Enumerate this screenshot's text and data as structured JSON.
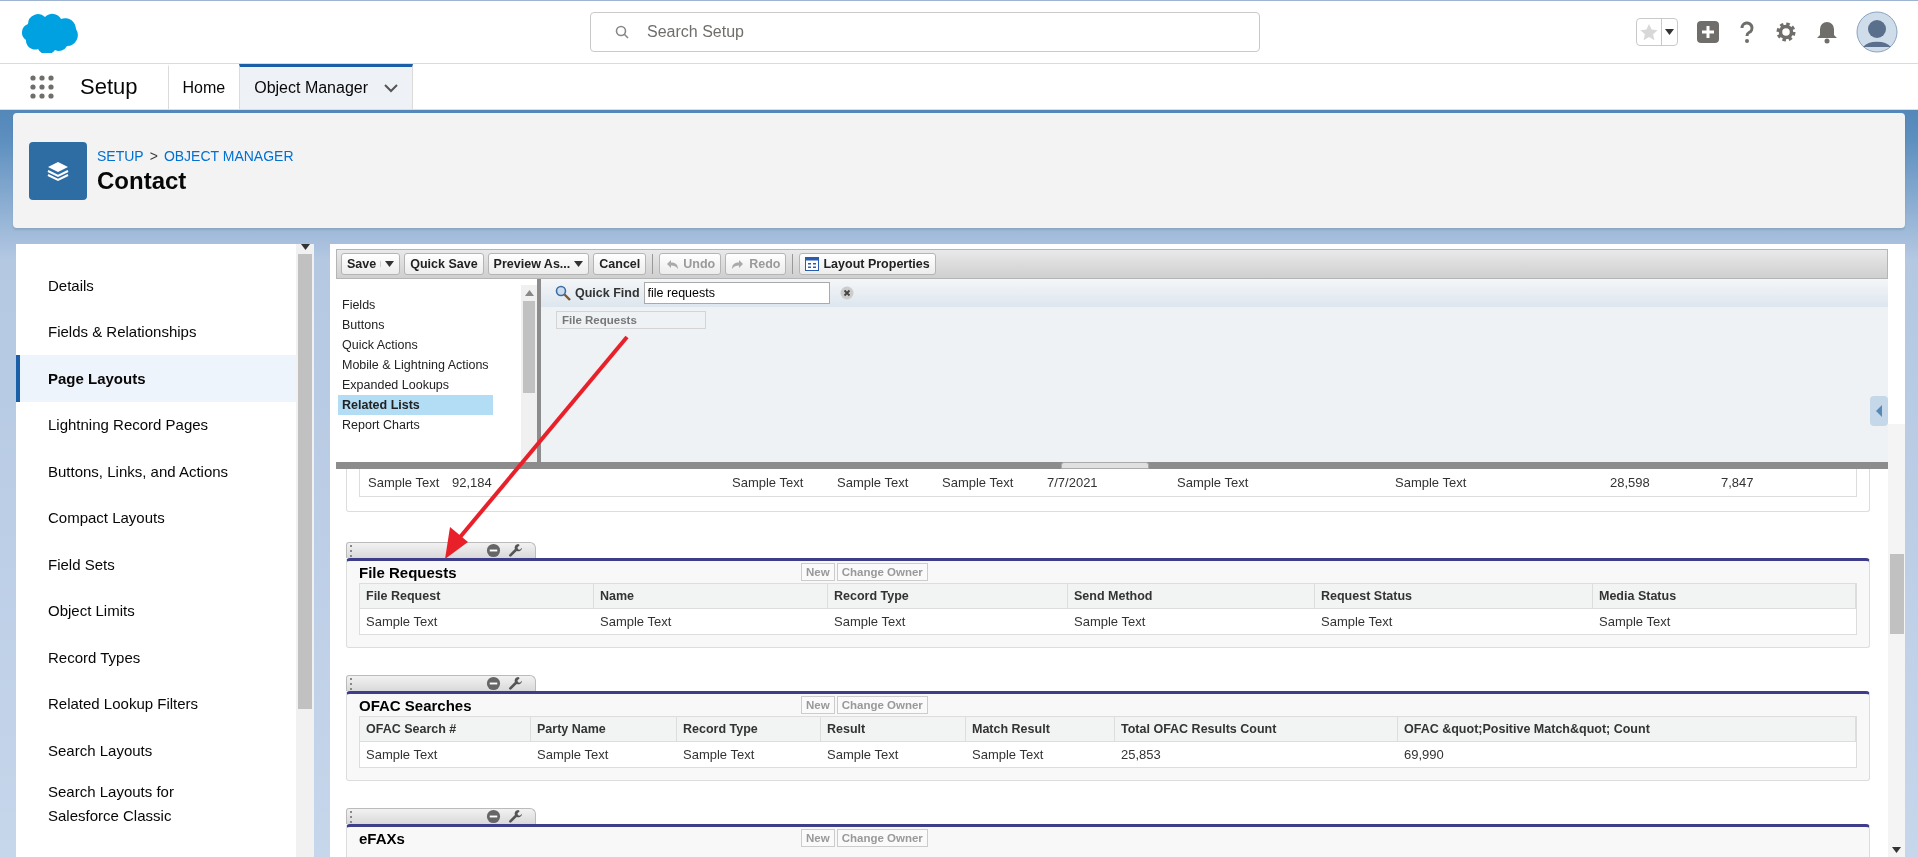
{
  "header": {
    "search": {
      "placeholder": "Search Setup"
    }
  },
  "nav": {
    "app_name": "Setup",
    "tabs": [
      {
        "label": "Home",
        "selected": false,
        "menu": false
      },
      {
        "label": "Object Manager",
        "selected": true,
        "menu": true
      }
    ]
  },
  "page_header": {
    "breadcrumbs": [
      "SETUP",
      "OBJECT MANAGER"
    ],
    "breadcrumb_separator": ">",
    "title": "Contact"
  },
  "sidebar": {
    "items": [
      {
        "label": "Details",
        "selected": false
      },
      {
        "label": "Fields & Relationships",
        "selected": false
      },
      {
        "label": "Page Layouts",
        "selected": true
      },
      {
        "label": "Lightning Record Pages",
        "selected": false
      },
      {
        "label": "Buttons, Links, and Actions",
        "selected": false
      },
      {
        "label": "Compact Layouts",
        "selected": false
      },
      {
        "label": "Field Sets",
        "selected": false
      },
      {
        "label": "Object Limits",
        "selected": false
      },
      {
        "label": "Record Types",
        "selected": false
      },
      {
        "label": "Related Lookup Filters",
        "selected": false
      },
      {
        "label": "Search Layouts",
        "selected": false
      },
      {
        "label": "Search Layouts for Salesforce Classic",
        "selected": false
      }
    ]
  },
  "toolbar": [
    {
      "kind": "split",
      "label": "Save",
      "disabled": false
    },
    {
      "kind": "plain",
      "label": "Quick Save",
      "disabled": false
    },
    {
      "kind": "menu",
      "label": "Preview As...",
      "disabled": false
    },
    {
      "kind": "plain",
      "label": "Cancel",
      "disabled": false
    },
    {
      "kind": "undo",
      "label": "Undo",
      "disabled": true
    },
    {
      "kind": "redo",
      "label": "Redo",
      "disabled": true
    },
    {
      "kind": "properties",
      "label": "Layout Properties",
      "disabled": false
    }
  ],
  "palette": {
    "categories": [
      {
        "label": "Fields",
        "selected": false
      },
      {
        "label": "Buttons",
        "selected": false
      },
      {
        "label": "Quick Actions",
        "selected": false
      },
      {
        "label": "Mobile & Lightning Actions",
        "selected": false
      },
      {
        "label": "Expanded Lookups",
        "selected": false
      },
      {
        "label": "Related Lists",
        "selected": true
      },
      {
        "label": "Report Charts",
        "selected": false
      }
    ],
    "quick_find": {
      "label": "Quick Find",
      "value": "file requests"
    },
    "results": [
      "File Requests"
    ]
  },
  "top_row": [
    "Sample Text",
    "92,184",
    "Sample Text",
    "Sample Text",
    "Sample Text",
    "7/7/2021",
    "Sample Text",
    "Sample Text",
    "28,598",
    "7,847"
  ],
  "sections": [
    {
      "title": "File Requests",
      "buttons": [
        "New",
        "Change Owner"
      ],
      "columns": [
        "File Request",
        "Name",
        "Record Type",
        "Send Method",
        "Request Status",
        "Media Status"
      ],
      "rows": [
        [
          "Sample Text",
          "Sample Text",
          "Sample Text",
          "Sample Text",
          "Sample Text",
          "Sample Text"
        ]
      ]
    },
    {
      "title": "OFAC Searches",
      "buttons": [
        "New",
        "Change Owner"
      ],
      "columns": [
        "OFAC Search #",
        "Party Name",
        "Record Type",
        "Result",
        "Match Result",
        "Total OFAC Results Count",
        "OFAC &quot;Positive Match&quot; Count"
      ],
      "rows": [
        [
          "Sample Text",
          "Sample Text",
          "Sample Text",
          "Sample Text",
          "Sample Text",
          "25,853",
          "69,990"
        ]
      ]
    },
    {
      "title": "eFAXs",
      "buttons": [
        "New",
        "Change Owner"
      ]
    }
  ]
}
